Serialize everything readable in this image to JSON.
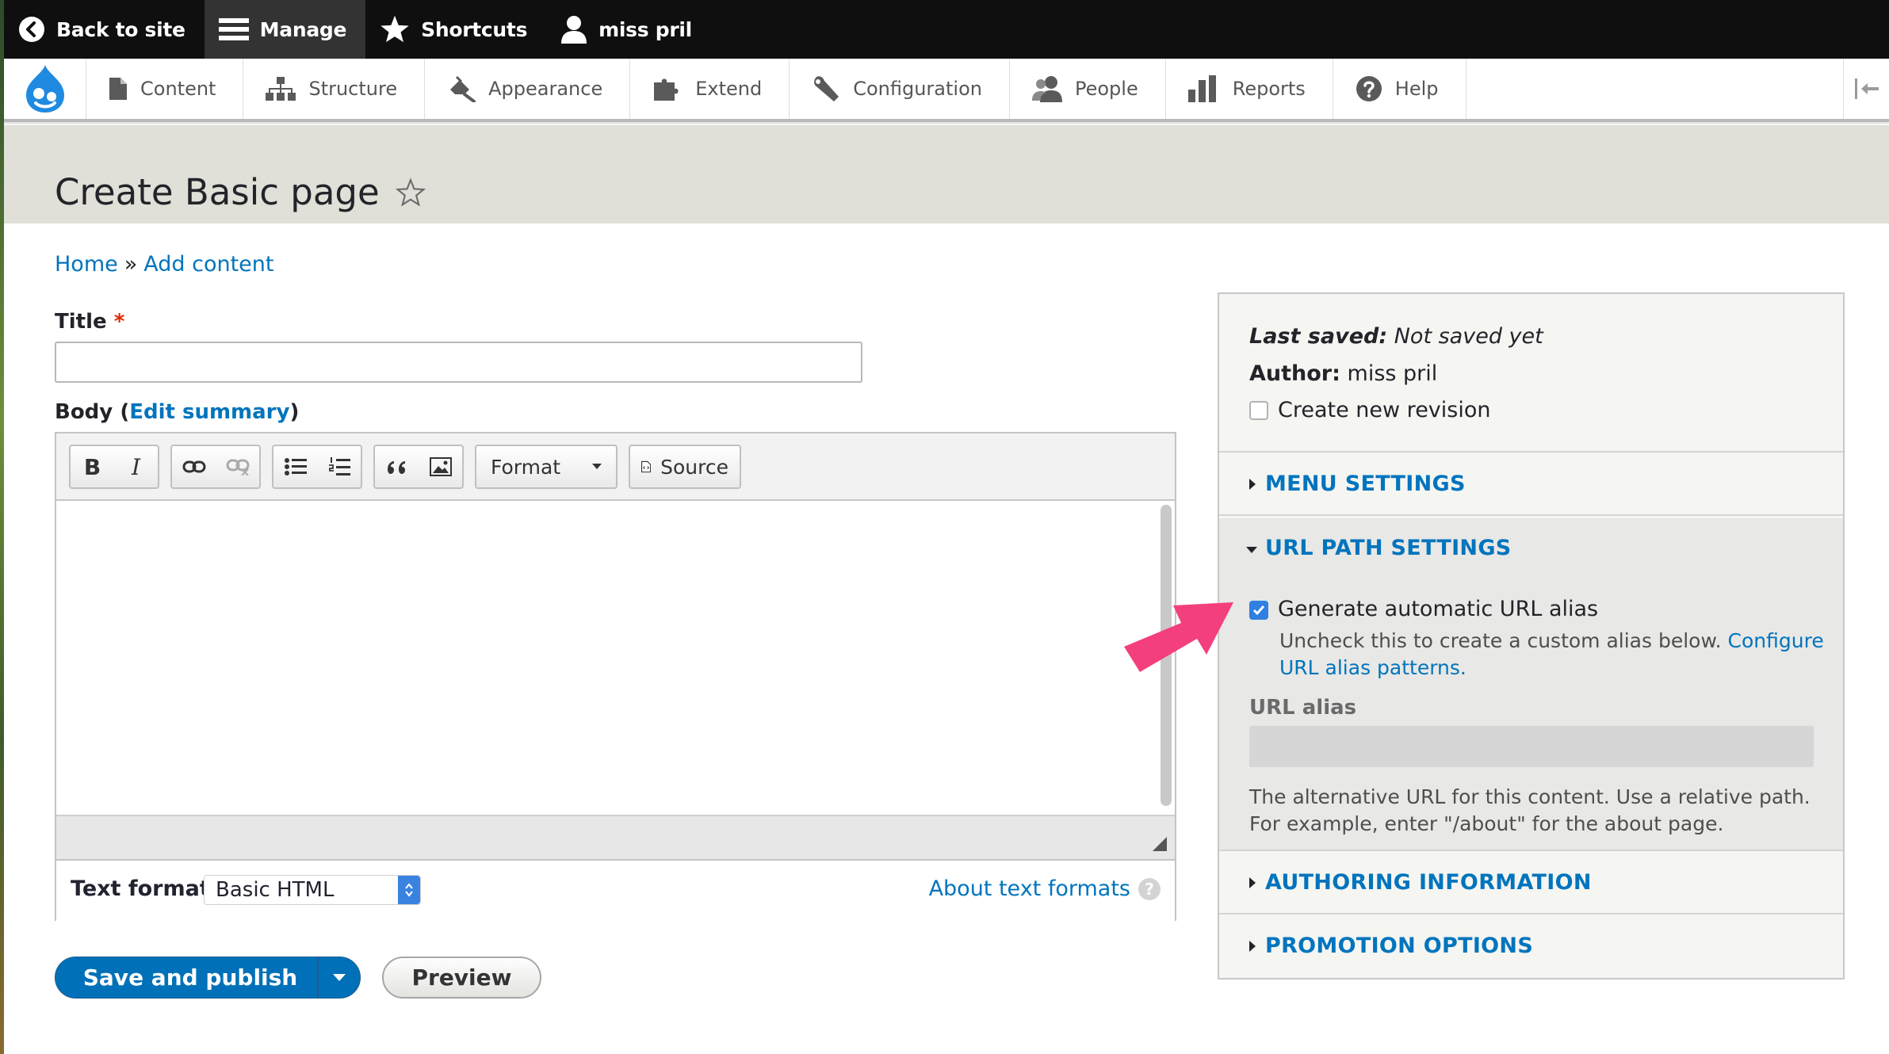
{
  "toolbar": {
    "back": "Back to site",
    "manage": "Manage",
    "shortcuts": "Shortcuts",
    "user": "miss pril"
  },
  "tray": {
    "items": [
      "Content",
      "Structure",
      "Appearance",
      "Extend",
      "Configuration",
      "People",
      "Reports",
      "Help"
    ]
  },
  "page": {
    "title": "Create Basic page"
  },
  "breadcrumb": {
    "home": "Home",
    "separator": "»",
    "add_content": "Add content"
  },
  "form": {
    "title_label": "Title",
    "required_mark": "*",
    "body_label": "Body",
    "body_open": "(",
    "edit_summary": "Edit summary",
    "body_close": ")",
    "editor": {
      "bold": "B",
      "italic": "I",
      "format_label": "Format",
      "source_label": "Source"
    },
    "text_format_label": "Text format",
    "text_format_value": "Basic HTML",
    "about_text_formats": "About text formats",
    "save_label": "Save and publish",
    "preview_label": "Preview"
  },
  "sidebar": {
    "last_saved_label": "Last saved:",
    "last_saved_value": "Not saved yet",
    "author_label": "Author:",
    "author_value": "miss pril",
    "create_revision": "Create new revision",
    "menu_settings": "MENU SETTINGS",
    "url_path_settings": "URL PATH SETTINGS",
    "generate_alias": "Generate automatic URL alias",
    "uncheck_text": "Uncheck this to create a custom alias below.",
    "configure_link_1": "Configure",
    "configure_link_2": "URL alias patterns.",
    "url_alias_label": "URL alias",
    "alias_help_1": "The alternative URL for this content. Use a relative path.",
    "alias_help_2": "For example, enter \"/about\" for the about page.",
    "authoring_information": "AUTHORING INFORMATION",
    "promotion_options": "PROMOTION OPTIONS"
  },
  "colors": {
    "link": "#0074bd",
    "primary_button": "#0071b8",
    "annotation_arrow": "#f43f7e"
  }
}
